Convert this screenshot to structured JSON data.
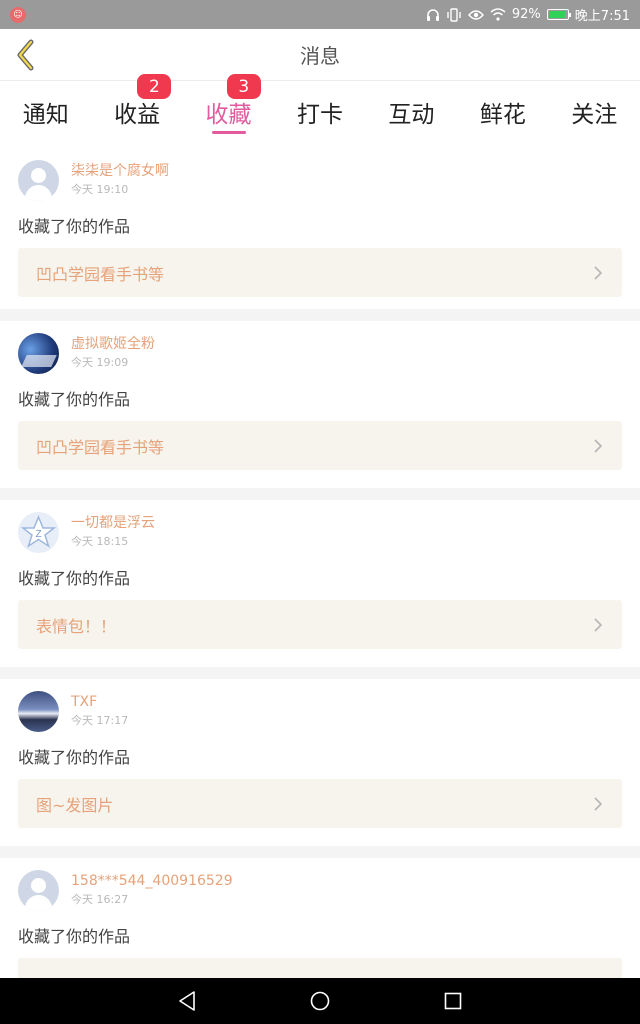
{
  "status_bar": {
    "battery_percent": "92%",
    "time": "晚上7:51"
  },
  "header": {
    "title": "消息"
  },
  "tabs": [
    {
      "label": "通知",
      "badge": ""
    },
    {
      "label": "收益",
      "badge": "2"
    },
    {
      "label": "收藏",
      "badge": "3",
      "active": true
    },
    {
      "label": "打卡",
      "badge": ""
    },
    {
      "label": "互动",
      "badge": ""
    },
    {
      "label": "鲜花",
      "badge": ""
    },
    {
      "label": "关注",
      "badge": ""
    }
  ],
  "items": [
    {
      "user": "柒柒是个腐女啊",
      "time": "今天 19:10",
      "action": "收藏了你的作品",
      "work": "凹凸学园看手书等"
    },
    {
      "user": "虚拟歌姬全粉",
      "time": "今天 19:09",
      "action": "收藏了你的作品",
      "work": "凹凸学园看手书等"
    },
    {
      "user": "一切都是浮云",
      "time": "今天 18:15",
      "action": "收藏了你的作品",
      "work": "表情包！！"
    },
    {
      "user": "TXF",
      "time": "今天 17:17",
      "action": "收藏了你的作品",
      "work": "图~发图片"
    },
    {
      "user": "158***544_400916529",
      "time": "今天 16:27",
      "action": "收藏了你的作品",
      "work": ""
    }
  ],
  "colors": {
    "accent": "#e25b9f",
    "badge": "#f0394f",
    "username": "#e6a27a"
  }
}
